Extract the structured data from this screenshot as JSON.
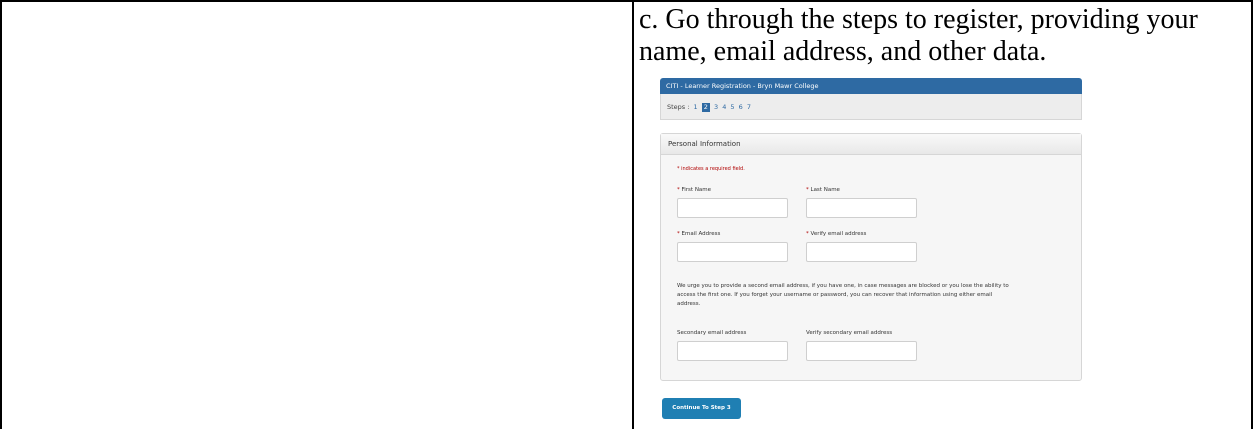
{
  "instruction": "c. Go through the steps to register, providing your name, email address, and other data.",
  "form": {
    "header_title": "CITI - Learner Registration - Bryn Mawr College",
    "steps_label": "Steps :",
    "steps": [
      "1",
      "2",
      "3",
      "4",
      "5",
      "6",
      "7"
    ],
    "active_step": "2",
    "panel_title": "Personal Information",
    "required_note": "* indicates a required field.",
    "fields": {
      "first_name": "First Name",
      "last_name": "Last Name",
      "email": "Email Address",
      "verify_email": "Verify email address",
      "secondary_email": "Secondary email address",
      "verify_secondary": "Verify secondary email address"
    },
    "required_star": "*",
    "urge_text_line1": "We urge you to provide a second email address, if you have one, in case messages are blocked or you lose the ability to",
    "urge_text_line2": "access the first one. If you forget your username or password, you can recover that information using either email",
    "urge_text_line3": "address.",
    "continue_button": "Continue To Step 3"
  },
  "colors": {
    "header_blue": "#2e6aa3",
    "button_blue": "#1f7fb3",
    "required_red": "#b00000"
  }
}
